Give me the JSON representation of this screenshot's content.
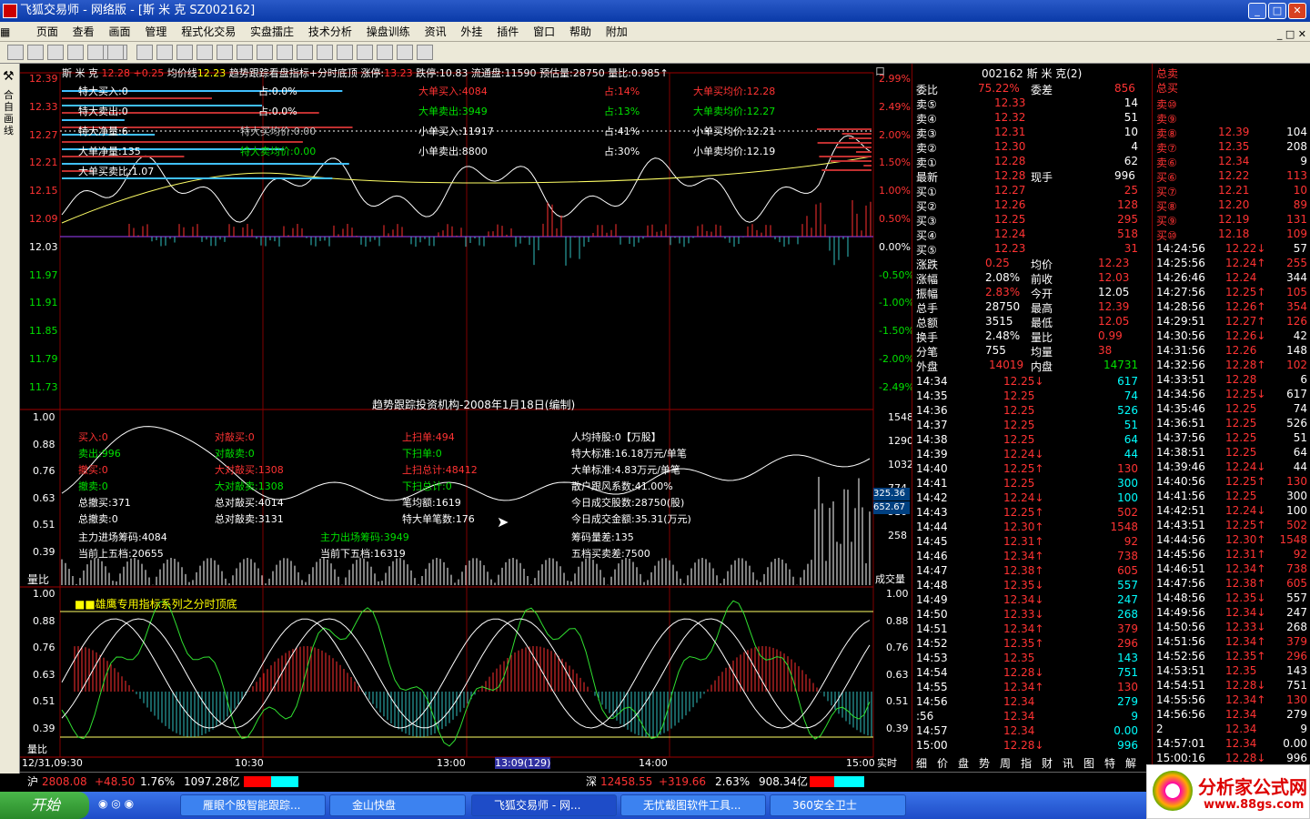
{
  "window": {
    "title": "飞狐交易师 - 网络版 - [斯 米 克 SZ002162]"
  },
  "menu": [
    "页面",
    "查看",
    "画面",
    "管理",
    "程式化交易",
    "实盘擂庄",
    "技术分析",
    "操盘训练",
    "资讯",
    "外挂",
    "插件",
    "窗口",
    "帮助",
    "附加"
  ],
  "toolbar": {
    "quan_label": "权"
  },
  "lefttab": {
    "label": "合自画线"
  },
  "header": {
    "stock": "斯 米 克",
    "price": "12.28",
    "chg": "+0.25",
    "avg_label": "均价线",
    "avg": "12.23",
    "indicator": "趋势跟踪看盘指标+分时底顶",
    "zt_label": "涨停:",
    "zt": "13.23",
    "dt": "跌停:10.83",
    "ltp": "流通盘:11590",
    "yg": "预估量:28750",
    "lb": "量比:0.985↑"
  },
  "price_axis": [
    "12.39",
    "12.33",
    "12.27",
    "12.21",
    "12.15",
    "12.09",
    "12.03",
    "11.97",
    "11.91",
    "11.85",
    "11.79",
    "11.73"
  ],
  "pct_axis": [
    "2.99%",
    "2.49%",
    "2.00%",
    "1.50%",
    "1.00%",
    "0.50%",
    "0.00%",
    "-0.50%",
    "-1.00%",
    "-1.50%",
    "-2.00%",
    "-2.49%"
  ],
  "top_info": [
    {
      "t": "特大买入:0",
      "c": "white"
    },
    {
      "t": "特大卖出:0",
      "c": "white"
    },
    {
      "t": "特大净量:6",
      "c": "white"
    },
    {
      "t": "大单净量:135",
      "c": "white"
    },
    {
      "t": "大单买卖比:1.07",
      "c": "white"
    },
    {
      "t": "占:0.0%",
      "c": "white"
    },
    {
      "t": "占:0.0%",
      "c": "white"
    },
    {
      "t": "特大买均价:0.00",
      "c": "gray"
    },
    {
      "t": "特大卖均价:0.00",
      "c": "green"
    },
    {
      "t": "大单买入:4084",
      "c": "red"
    },
    {
      "t": "大单卖出:3949",
      "c": "green"
    },
    {
      "t": "小单买入:11917",
      "c": "white"
    },
    {
      "t": "小单卖出:8800",
      "c": "white"
    },
    {
      "t": "占:14%",
      "c": "red"
    },
    {
      "t": "占:13%",
      "c": "green"
    },
    {
      "t": "占:41%",
      "c": "white"
    },
    {
      "t": "占:30%",
      "c": "white"
    },
    {
      "t": "大单买均价:12.28",
      "c": "red"
    },
    {
      "t": "大单卖均价:12.27",
      "c": "green"
    },
    {
      "t": "小单买均价:12.21",
      "c": "white"
    },
    {
      "t": "小单卖均价:12.19",
      "c": "white"
    }
  ],
  "chart_caption": "趋势跟踪投资机构-2008年1月18日(编制)",
  "mid_axis": [
    "1.00",
    "0.88",
    "0.76",
    "0.63",
    "0.51",
    "0.39"
  ],
  "vol_axis": [
    "1548",
    "1290",
    "1032",
    "774",
    "516",
    "258"
  ],
  "vol_marks": [
    "325.36",
    "652.67"
  ],
  "vol_labels": {
    "left": "量比",
    "right": "成交量"
  },
  "mid_info": [
    {
      "t": "买入:0",
      "c": "red"
    },
    {
      "t": "卖出:996",
      "c": "green"
    },
    {
      "t": "撤买:0",
      "c": "red"
    },
    {
      "t": "撤卖:0",
      "c": "green"
    },
    {
      "t": "总撤买:371",
      "c": "white"
    },
    {
      "t": "总撤卖:0",
      "c": "white"
    },
    {
      "t": "对敲买:0",
      "c": "red"
    },
    {
      "t": "对敲卖:0",
      "c": "green"
    },
    {
      "t": "大对敲买:1308",
      "c": "red"
    },
    {
      "t": "大对敲卖:1308",
      "c": "green"
    },
    {
      "t": "总对敲买:4014",
      "c": "white"
    },
    {
      "t": "总对敲卖:3131",
      "c": "white"
    },
    {
      "t": "上扫单:494",
      "c": "red"
    },
    {
      "t": "下扫单:0",
      "c": "green"
    },
    {
      "t": "上扫总计:48412",
      "c": "red"
    },
    {
      "t": "下扫总计:0",
      "c": "green"
    },
    {
      "t": "笔均额:1619",
      "c": "white"
    },
    {
      "t": "特大单笔数:176",
      "c": "white"
    },
    {
      "t": "人均持股:0【万股】",
      "c": "white"
    },
    {
      "t": "特大标准:16.18万元/单笔",
      "c": "white"
    },
    {
      "t": "大单标准:4.83万元/单笔",
      "c": "white"
    },
    {
      "t": "散户跟风系数:41.00%",
      "c": "white"
    },
    {
      "t": "今日成交股数:28750(股)",
      "c": "white"
    },
    {
      "t": "今日成交金额:35.31(万元)",
      "c": "white"
    },
    {
      "t": "主力进场筹码:4084",
      "c": "white"
    },
    {
      "t": "当前上五档:20655",
      "c": "white"
    },
    {
      "t": "主力出场筹码:3949",
      "c": "green"
    },
    {
      "t": "当前下五档:16319",
      "c": "white"
    },
    {
      "t": "筹码量差:135",
      "c": "white"
    },
    {
      "t": "五档买卖差:7500",
      "c": "white"
    }
  ],
  "bottom_title": "■■雄鹰专用指标系列之分时顶底",
  "bottom_axis": [
    "1.00",
    "0.88",
    "0.76",
    "0.63",
    "0.51",
    "0.39"
  ],
  "time_axis": [
    "12/31,09:30",
    "10:30",
    "13:00",
    "13:09(129)",
    "14:00",
    "15:00"
  ],
  "time_right": "实时",
  "quote": {
    "code": "002162 斯 米 克(2)",
    "weibi_l": "委比",
    "weibi": "75.22%",
    "weicha_l": "委差",
    "weicha": "856",
    "sells": [
      {
        "l": "卖⑤",
        "p": "12.33",
        "v": "14"
      },
      {
        "l": "卖④",
        "p": "12.32",
        "v": "51"
      },
      {
        "l": "卖③",
        "p": "12.31",
        "v": "10"
      },
      {
        "l": "卖②",
        "p": "12.30",
        "v": "4"
      },
      {
        "l": "卖①",
        "p": "12.28",
        "v": "62"
      }
    ],
    "latest_l": "最新",
    "latest": "12.28",
    "xianshou_l": "现手",
    "xianshou": "996",
    "buys": [
      {
        "l": "买①",
        "p": "12.27",
        "v": "25"
      },
      {
        "l": "买②",
        "p": "12.26",
        "v": "128"
      },
      {
        "l": "买③",
        "p": "12.25",
        "v": "295"
      },
      {
        "l": "买④",
        "p": "12.24",
        "v": "518"
      },
      {
        "l": "买⑤",
        "p": "12.23",
        "v": "31"
      }
    ],
    "stats": [
      [
        "涨跌",
        "0.25",
        "均价",
        "12.23"
      ],
      [
        "涨幅",
        "2.08%",
        "前收",
        "12.03"
      ],
      [
        "振幅",
        "2.83%",
        "今开",
        "12.05"
      ],
      [
        "总手",
        "28750",
        "最高",
        "12.39"
      ],
      [
        "总额",
        "3515",
        "最低",
        "12.05"
      ],
      [
        "换手",
        "2.48%",
        "量比",
        "0.99"
      ],
      [
        "分笔",
        "755",
        "均量",
        "38"
      ]
    ],
    "waipan_l": "外盘",
    "waipan": "14019",
    "neipan_l": "内盘",
    "neipan": "14731"
  },
  "ticks": [
    [
      "14:34",
      "12.25↓",
      "617"
    ],
    [
      "14:35",
      "12.25",
      "74"
    ],
    [
      "14:36",
      "12.25",
      "526"
    ],
    [
      "14:37",
      "12.25",
      "51"
    ],
    [
      "14:38",
      "12.25",
      "64"
    ],
    [
      "14:39",
      "12.24↓",
      "44"
    ],
    [
      "14:40",
      "12.25↑",
      "130"
    ],
    [
      "14:41",
      "12.25",
      "300"
    ],
    [
      "14:42",
      "12.24↓",
      "100"
    ],
    [
      "14:43",
      "12.25↑",
      "502"
    ],
    [
      "14:44",
      "12.30↑",
      "1548"
    ],
    [
      "14:45",
      "12.31↑",
      "92"
    ],
    [
      "14:46",
      "12.34↑",
      "738"
    ],
    [
      "14:47",
      "12.38↑",
      "605"
    ],
    [
      "14:48",
      "12.35↓",
      "557"
    ],
    [
      "14:49",
      "12.34↓",
      "247"
    ],
    [
      "14:50",
      "12.33↓",
      "268"
    ],
    [
      "14:51",
      "12.34↑",
      "379"
    ],
    [
      "14:52",
      "12.35↑",
      "296"
    ],
    [
      "14:53",
      "12.35",
      "143"
    ],
    [
      "14:54",
      "12.28↓",
      "751"
    ],
    [
      "14:55",
      "12.34↑",
      "130"
    ],
    [
      "14:56",
      "12.34",
      "279"
    ],
    [
      ":56",
      "12.34",
      "9"
    ],
    [
      "14:57",
      "12.34",
      "0.00"
    ],
    [
      "15:00",
      "12.28↓",
      "996"
    ]
  ],
  "bottom_tabs": [
    "细",
    "价",
    "盘",
    "势",
    "周",
    "指",
    "财",
    "讯",
    "图",
    "特",
    "解"
  ],
  "far": {
    "top": [
      [
        "总卖",
        ""
      ],
      [
        "总买",
        ""
      ]
    ],
    "sells": [
      [
        "卖⑩",
        "",
        ""
      ],
      [
        "卖⑨",
        "",
        ""
      ],
      [
        "卖⑧",
        "12.39",
        "104"
      ],
      [
        "卖⑦",
        "12.35",
        "208"
      ],
      [
        "卖⑥",
        "12.34",
        "9"
      ]
    ],
    "buys": [
      [
        "买⑥",
        "12.22",
        "113"
      ],
      [
        "买⑦",
        "12.21",
        "10"
      ],
      [
        "买⑧",
        "12.20",
        "89"
      ],
      [
        "买⑨",
        "12.19",
        "131"
      ],
      [
        "买⑩",
        "12.18",
        "109"
      ]
    ],
    "ticks": [
      [
        "14:24:56",
        "12.22↓",
        "57"
      ],
      [
        "14:25:56",
        "12.24↑",
        "255"
      ],
      [
        "14:26:46",
        "12.24",
        "344"
      ],
      [
        "14:27:56",
        "12.25↑",
        "105"
      ],
      [
        "14:28:56",
        "12.26↑",
        "354"
      ],
      [
        "14:29:51",
        "12.27↑",
        "126"
      ],
      [
        "14:30:56",
        "12.26↓",
        "42"
      ],
      [
        "14:31:56",
        "12.26",
        "148"
      ],
      [
        "14:32:56",
        "12.28↑",
        "102"
      ],
      [
        "14:33:51",
        "12.28",
        "6"
      ],
      [
        "14:34:56",
        "12.25↓",
        "617"
      ],
      [
        "14:35:46",
        "12.25",
        "74"
      ],
      [
        "14:36:51",
        "12.25",
        "526"
      ],
      [
        "14:37:56",
        "12.25",
        "51"
      ],
      [
        "14:38:51",
        "12.25",
        "64"
      ],
      [
        "14:39:46",
        "12.24↓",
        "44"
      ],
      [
        "14:40:56",
        "12.25↑",
        "130"
      ],
      [
        "14:41:56",
        "12.25",
        "300"
      ],
      [
        "14:42:51",
        "12.24↓",
        "100"
      ],
      [
        "14:43:51",
        "12.25↑",
        "502"
      ],
      [
        "14:44:56",
        "12.30↑",
        "1548"
      ],
      [
        "14:45:56",
        "12.31↑",
        "92"
      ],
      [
        "14:46:51",
        "12.34↑",
        "738"
      ],
      [
        "14:47:56",
        "12.38↑",
        "605"
      ],
      [
        "14:48:56",
        "12.35↓",
        "557"
      ],
      [
        "14:49:56",
        "12.34↓",
        "247"
      ],
      [
        "14:50:56",
        "12.33↓",
        "268"
      ],
      [
        "14:51:56",
        "12.34↑",
        "379"
      ],
      [
        "14:52:56",
        "12.35↑",
        "296"
      ],
      [
        "14:53:51",
        "12.35",
        "143"
      ],
      [
        "14:54:51",
        "12.28↓",
        "751"
      ],
      [
        "14:55:56",
        "12.34↑",
        "130"
      ],
      [
        "14:56:56",
        "12.34",
        "279"
      ],
      [
        "2",
        "12.34",
        "9"
      ],
      [
        "14:57:01",
        "12.34",
        "0.00"
      ],
      [
        "15:00:16",
        "12.28↓",
        "996"
      ]
    ]
  },
  "status": {
    "sh_l": "沪",
    "sh": "2808.08",
    "sh_chg": "+48.50",
    "sh_pct": "1.76%",
    "sh_amt": "1097.28亿",
    "sz_l": "深",
    "sz": "12458.55",
    "sz_chg": "+319.66",
    "sz_pct": "2.63%",
    "sz_amt": "908.34亿"
  },
  "taskbar": {
    "start": "开始",
    "tasks": [
      "雁眼个股智能跟踪...",
      "金山快盘",
      "飞狐交易师 - 网...",
      "无忧截图软件工具...",
      "360安全卫士"
    ]
  },
  "brand": {
    "name": "分析家公式网",
    "url": "www.88gs.com"
  },
  "colors": {
    "up": "#ff3333",
    "down": "#00e000",
    "bg": "#000000",
    "grid": "#800000"
  }
}
